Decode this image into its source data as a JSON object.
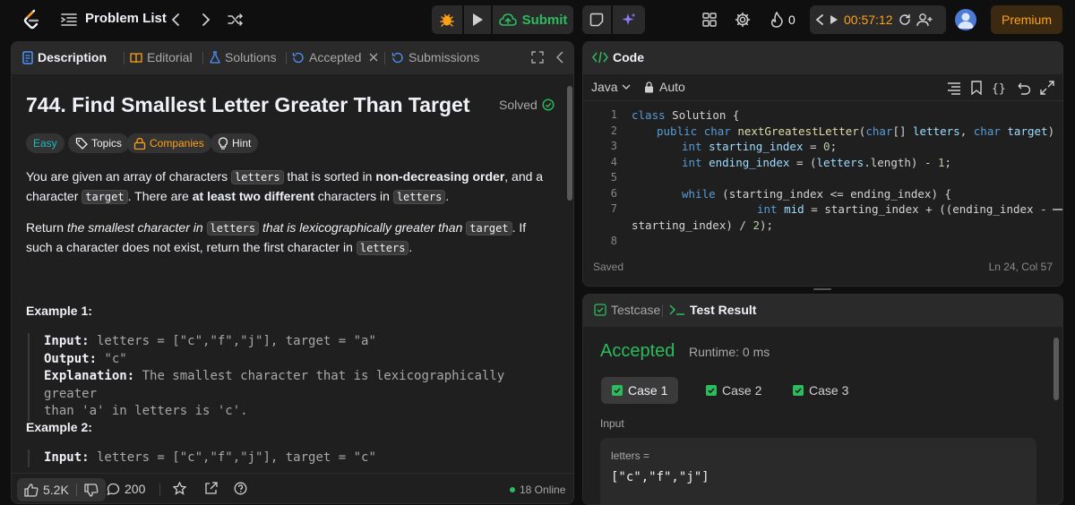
{
  "topbar": {
    "problem_list": "Problem List",
    "submit_label": "Submit",
    "streak_count": "0",
    "timer": "00:57:12",
    "premium": "Premium"
  },
  "description_panel": {
    "tabs": [
      "Description",
      "Editorial",
      "Solutions",
      "Accepted",
      "Submissions"
    ],
    "title": "744. Find Smallest Letter Greater Than Target",
    "solved": "Solved",
    "difficulty": "Easy",
    "topics": "Topics",
    "companies": "Companies",
    "hint": "Hint",
    "para1": [
      "You are given an array of characters ",
      "letters",
      " that is sorted in ",
      "non-decreasing order",
      ", and a character ",
      "target",
      ". There are ",
      "at least two different",
      " characters in ",
      "letters",
      "."
    ],
    "para2": [
      "Return ",
      "the smallest character in ",
      "letters",
      " that is lexicographically greater than ",
      "target",
      ". If such a character does not exist, return the first character in ",
      "letters",
      "."
    ],
    "example1": {
      "title": "Example 1:",
      "input_label": "Input:",
      "input": " letters = [\"c\",\"f\",\"j\"], target = \"a\"",
      "output_label": "Output:",
      "output": " \"c\"",
      "explanation_label": "Explanation:",
      "explanation_1": " The smallest character that is lexicographically greater",
      "explanation_2": "than 'a' in letters is 'c'."
    },
    "example2": {
      "title": "Example 2:",
      "input_label": "Input:",
      "input": " letters = [\"c\",\"f\",\"j\"], target = \"c\""
    },
    "likes": "5.2K",
    "comments": "200",
    "online": "18 Online"
  },
  "code_panel": {
    "title": "Code",
    "language": "Java",
    "mode": "Auto",
    "line_numbers": [
      "1",
      "2",
      "3",
      "4",
      "5",
      "6",
      "7",
      "8"
    ],
    "saved": "Saved",
    "cursor": "Ln 24, Col 57"
  },
  "test_panel": {
    "tab_testcase": "Testcase",
    "tab_result": "Test Result",
    "status": "Accepted",
    "runtime": "Runtime: 0 ms",
    "cases": [
      "Case 1",
      "Case 2",
      "Case 3"
    ],
    "input_label": "Input",
    "input_var": "letters =",
    "input_value": "[\"c\",\"f\",\"j\"]"
  },
  "colors": {
    "accent_orange": "#ffa116",
    "accepted_green": "#2cbb5d",
    "easy_teal": "#1cbaba",
    "panel_bg": "#1f1f1f",
    "page_bg": "#0f0f0f"
  },
  "icons": [
    "leetcode-logo-icon",
    "list-icon",
    "chevron-left-icon",
    "chevron-right-icon",
    "shuffle-icon",
    "bug-icon",
    "play-icon",
    "cloud-upload-icon",
    "note-icon",
    "sparkle-icon",
    "layout-icon",
    "gear-icon",
    "flame-icon",
    "reset-icon",
    "add-user-icon",
    "avatar-icon"
  ]
}
